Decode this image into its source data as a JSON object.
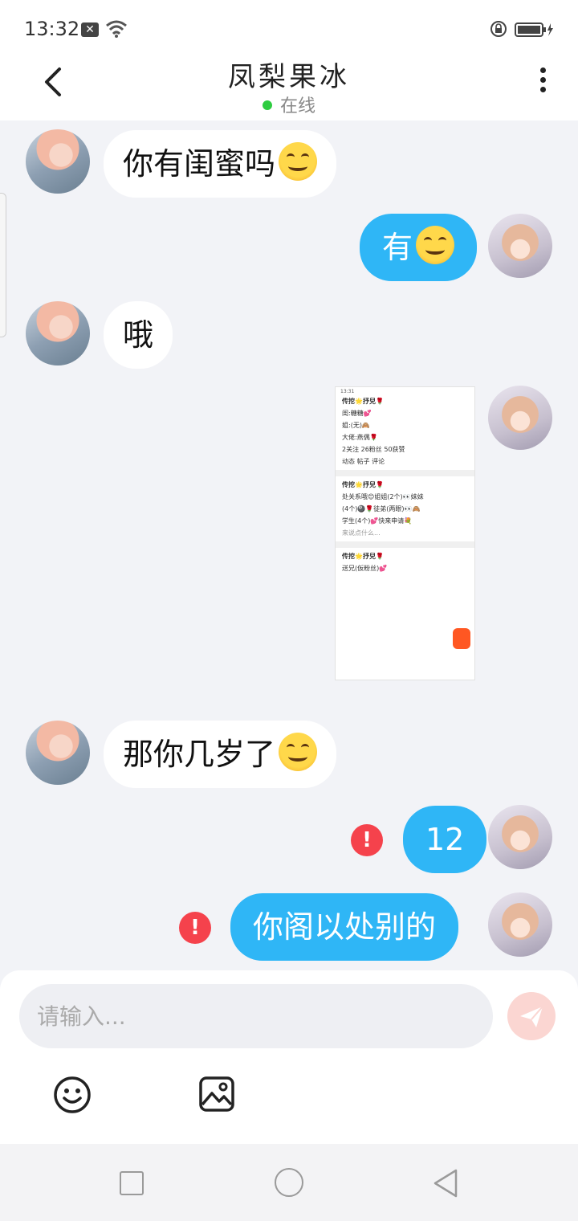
{
  "status_bar": {
    "time": "13:32",
    "sim_badge": "✕"
  },
  "header": {
    "title": "凤梨果冰",
    "status": "在线",
    "icons": [
      "back-arrow-icon",
      "more-vertical-icon"
    ]
  },
  "messages": [
    {
      "from": "her",
      "text": "你有闺蜜吗",
      "emoji": "😊"
    },
    {
      "from": "me",
      "text": "有",
      "emoji": "😊"
    },
    {
      "from": "her",
      "text": "哦"
    },
    {
      "from": "me",
      "type": "image"
    },
    {
      "from": "her",
      "text": "那你几岁了",
      "emoji": "😊"
    },
    {
      "from": "me",
      "text": "12",
      "failed": true
    },
    {
      "from": "me",
      "text": "你阁以处别的",
      "failed": true
    }
  ],
  "shared_screenshot": {
    "time": "13:31",
    "lines": [
      "传挖🌟抒兒🌹",
      "闺:糖糖💕",
      "姐:(无)🙈",
      "大佬:燕偶🌹",
      "2关注   26粉丝   50获赞",
      "动态   帖子   评论",
      "传挖🌟抒兒🌹",
      "处关系哦😊姐姐(2个)👀妹妹",
      "(4个)🎱🌹徒弟(两眼)👀🙈",
      "学生(4个)💕快来申请💐",
      "来说点什么...",
      "传挖🌟抒兒🌹",
      "送兄(仮粉丝)💕"
    ]
  },
  "composer": {
    "placeholder": "请输入...",
    "icons": [
      "emoji-icon",
      "image-icon",
      "send-icon"
    ]
  },
  "error_mark": "!",
  "colors": {
    "accent": "#2fb6f6",
    "error": "#f5424c",
    "online": "#2ecc40"
  }
}
